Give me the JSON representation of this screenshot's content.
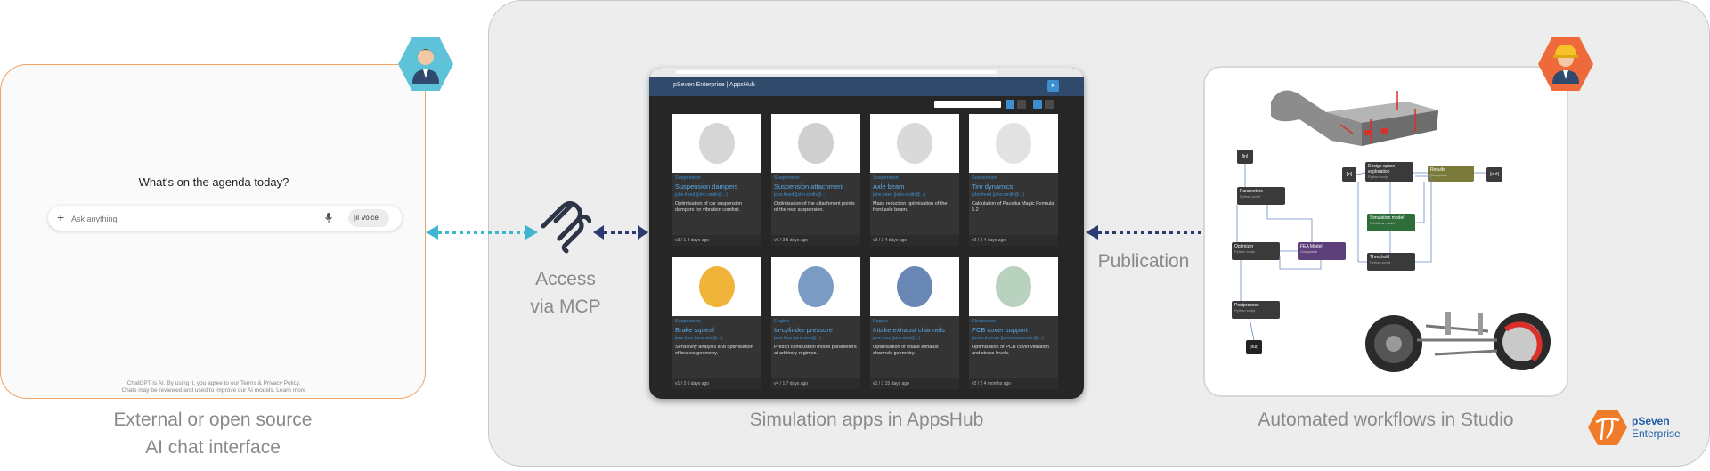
{
  "chat": {
    "heading": "What's on the agenda today?",
    "placeholder": "Ask anything",
    "voice_label": "Voice",
    "footer_line1": "ChatGPT is AI. By using it, you agree to our Terms & Privacy Policy.",
    "footer_line2": "Chats may be reviewed and used to improve our AI models. Learn more",
    "caption_line1": "External or open source",
    "caption_line2": "AI chat interface"
  },
  "mcp": {
    "caption_line1": "Access",
    "caption_line2": "via MCP"
  },
  "appshub": {
    "header_title": "pSeven Enterprise | AppsHub",
    "caption": "Simulation apps in AppsHub",
    "cards": [
      {
        "category": "Suspension",
        "title": "Suspension dampers",
        "owner": "john.freed (john.smith@...)",
        "description": "Optimisation of car suspension dampers for vibration comfort.",
        "version": "v3 / 1",
        "age": "3 days ago"
      },
      {
        "category": "Suspension",
        "title": "Suspension attachment",
        "owner": "john.freed (john.smith@...)",
        "description": "Optimisation of the attachment points of the rear suspension.",
        "version": "v9 / 3",
        "age": "5 days ago"
      },
      {
        "category": "Suspension",
        "title": "Axle beam",
        "owner": "john.freed (john.smith@...)",
        "description": "Mass reduction optimisation of the front axle beam.",
        "version": "v9 / 1",
        "age": "4 days ago"
      },
      {
        "category": "Suspension",
        "title": "Tire dynamics",
        "owner": "john.freed (john.smith@...)",
        "description": "Calculation of Pacejka Magic Formula 5.2",
        "version": "v2 / 2",
        "age": "4 days ago"
      },
      {
        "category": "Suspension",
        "title": "Brake squeal",
        "owner": "jane.foss (jane.doe@...)",
        "description": "Sensitivity analysis and optimisation of brakes geometry.",
        "version": "v1 / 2",
        "age": "6 days ago"
      },
      {
        "category": "Engine",
        "title": "In-cylinder pressure",
        "owner": "jane.foss (jane.doe@...)",
        "description": "Predict combustion model parameters at arbitrary regimes.",
        "version": "v4 / 1",
        "age": "7 days ago"
      },
      {
        "category": "Engine",
        "title": "Intake exhaust channels",
        "owner": "jane.foss (jane.doe@...)",
        "description": "Optimisation of intake exhaust channels geometry.",
        "version": "v1 / 3",
        "age": "15 days ago"
      },
      {
        "category": "Electronics",
        "title": "PCB cover support",
        "owner": "james.thomas (james.anderson@...)",
        "description": "Optimisation of PCB cover vibration and stress levels.",
        "version": "v2 / 2",
        "age": "4 months ago"
      }
    ]
  },
  "studio": {
    "publication_label": "Publication",
    "caption": "Automated workflows in Studio",
    "nodes": {
      "in_left": "[in]",
      "parameters": "Parameters",
      "parameters_sub": "Python script",
      "optimizer": "Optimizer",
      "optimizer_sub": "Python script",
      "fea_model": "FEA Model",
      "fea_model_sub": "Composite",
      "postprocess": "Postprocess",
      "postprocess_sub": "Python script",
      "out_left": "[out]",
      "in_right": "[in]",
      "design_space": "Design space exploration",
      "design_space_sub": "Python script",
      "results": "Results",
      "results_sub": "Composite",
      "out_right": "[out]",
      "simulation_model": "Simulation model",
      "simulation_model_sub": "Workflow model",
      "threshold": "Threshold",
      "threshold_sub": "Python script"
    }
  },
  "brand": {
    "line1": "pSeven",
    "line2": "Enterprise"
  },
  "colors": {
    "chat_border": "#f0a468",
    "hex_user_blue": "#5ec3d8",
    "hex_engineer_orange": "#ef6a3a",
    "arrow_light": "#3fb6cf",
    "arrow_dark": "#2c3a73",
    "appshub_header": "#304a6b",
    "link_blue": "#5aa9e6",
    "brand_blue": "#1f5fa8",
    "brand_orange": "#f07c2a"
  }
}
